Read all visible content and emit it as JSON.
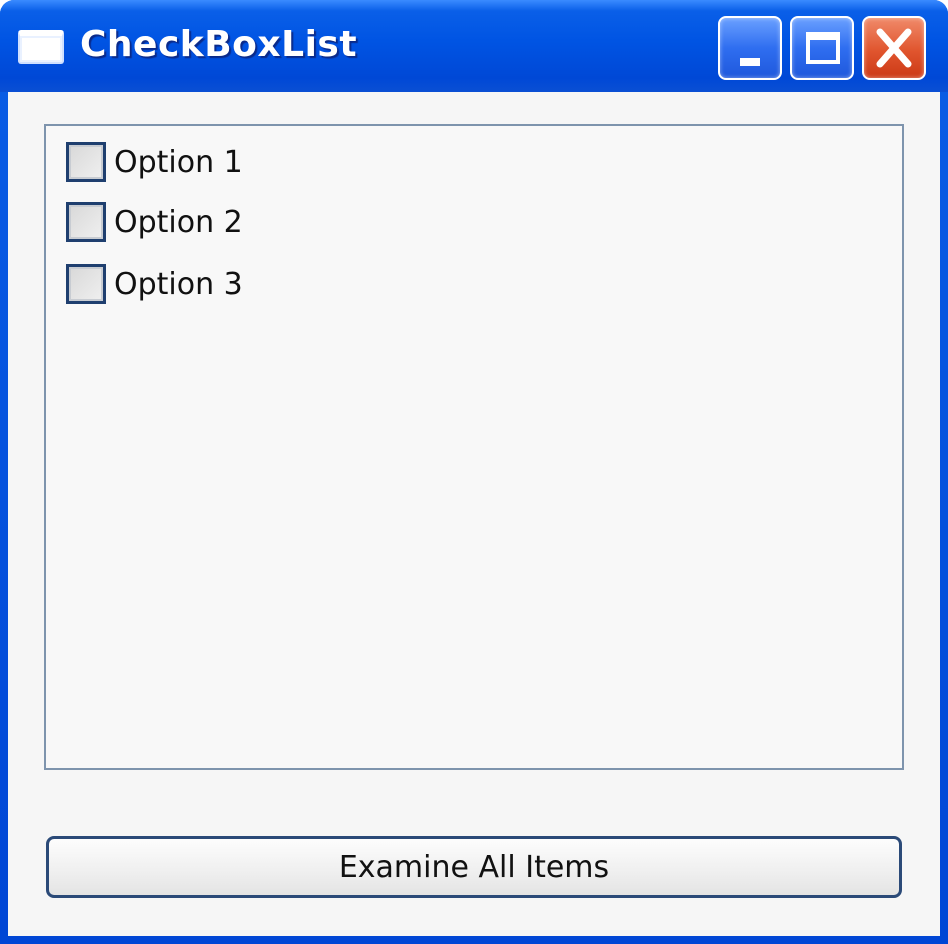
{
  "window": {
    "title": "CheckBoxList",
    "title_color": "#ffffff",
    "titlebar_color": "#0054e3"
  },
  "titlebar_buttons": [
    {
      "icon": "minimize-icon"
    },
    {
      "icon": "maximize-icon"
    },
    {
      "icon": "close-icon",
      "color": "#e0552e"
    }
  ],
  "checklist": {
    "items": [
      {
        "label": "Option 1",
        "checked": false
      },
      {
        "label": "Option 2",
        "checked": false
      },
      {
        "label": "Option 3",
        "checked": false
      }
    ]
  },
  "actions": {
    "examine_label": "Examine All Items"
  }
}
